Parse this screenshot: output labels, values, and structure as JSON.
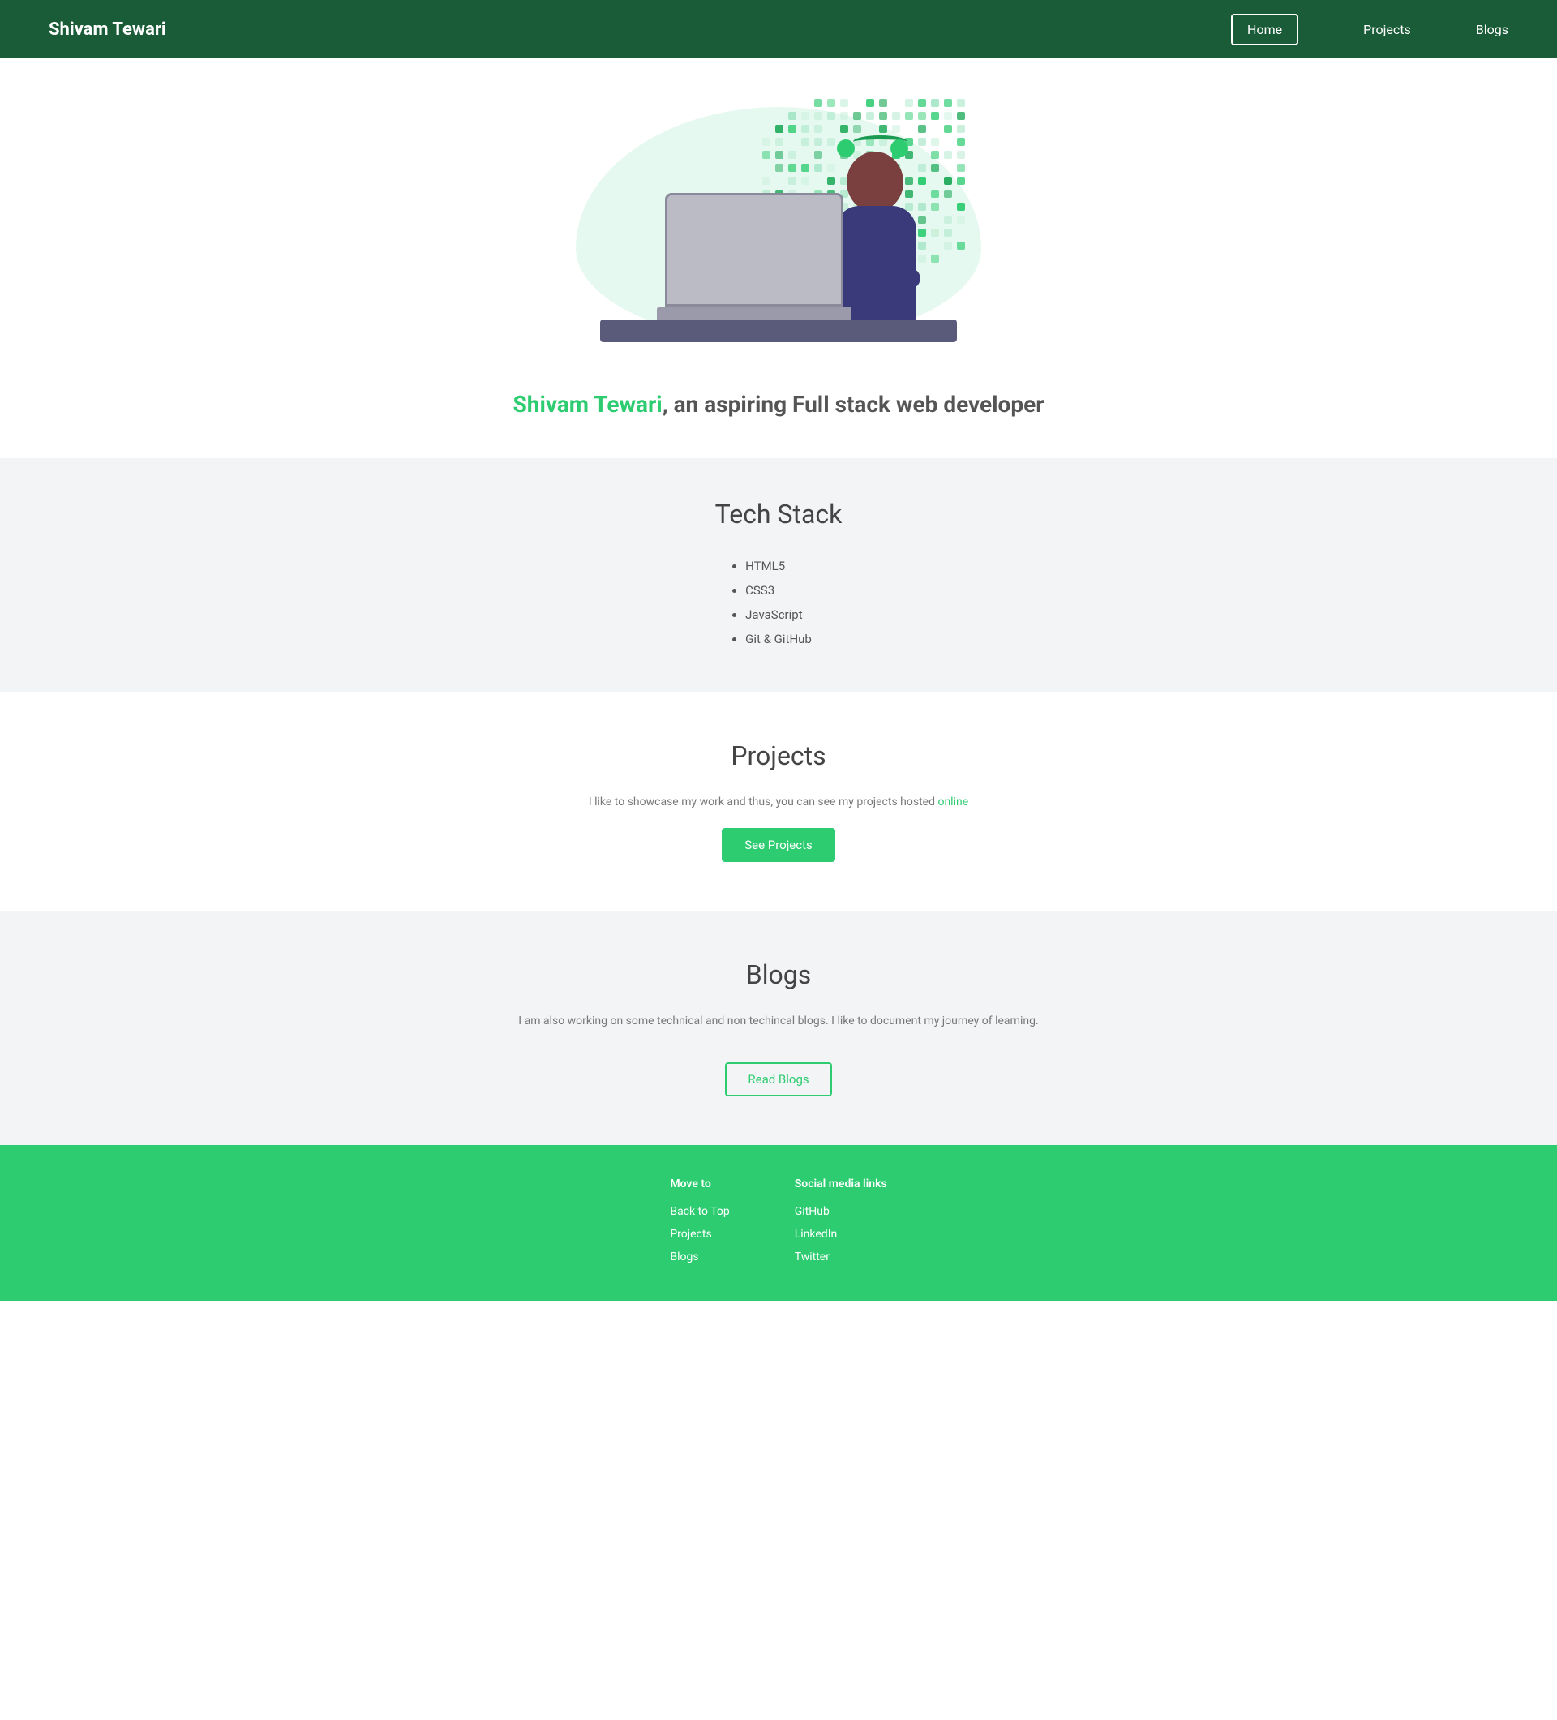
{
  "nav": {
    "brand": "Shivam Tewari",
    "links": [
      {
        "label": "Home",
        "active": true
      },
      {
        "label": "Projects",
        "active": false
      },
      {
        "label": "Blogs",
        "active": false
      }
    ]
  },
  "hero": {
    "tagline_name": "Shivam Tewari",
    "tagline_rest": ", an aspiring Full stack web developer"
  },
  "techStack": {
    "title": "Tech Stack",
    "items": [
      "HTML5",
      "CSS3",
      "JavaScript",
      "Git & GitHub"
    ]
  },
  "projects": {
    "title": "Projects",
    "description": "I like to showcase my work and thus, you can see my projects hosted ",
    "description_link": "online",
    "button": "See Projects"
  },
  "blogs": {
    "title": "Blogs",
    "description": "I am also working on some technical and non techincal blogs. I like to document my journey of learning.",
    "button": "Read Blogs"
  },
  "footer": {
    "move_to_title": "Move to",
    "move_to_links": [
      "Back to Top",
      "Projects",
      "Blogs"
    ],
    "social_title": "Social media links",
    "social_links": [
      "GitHub",
      "LinkedIn",
      "Twitter"
    ]
  },
  "colors": {
    "green": "#2ecc71",
    "dark_green": "#1a5c38",
    "light_green": "#e6f9f0"
  }
}
